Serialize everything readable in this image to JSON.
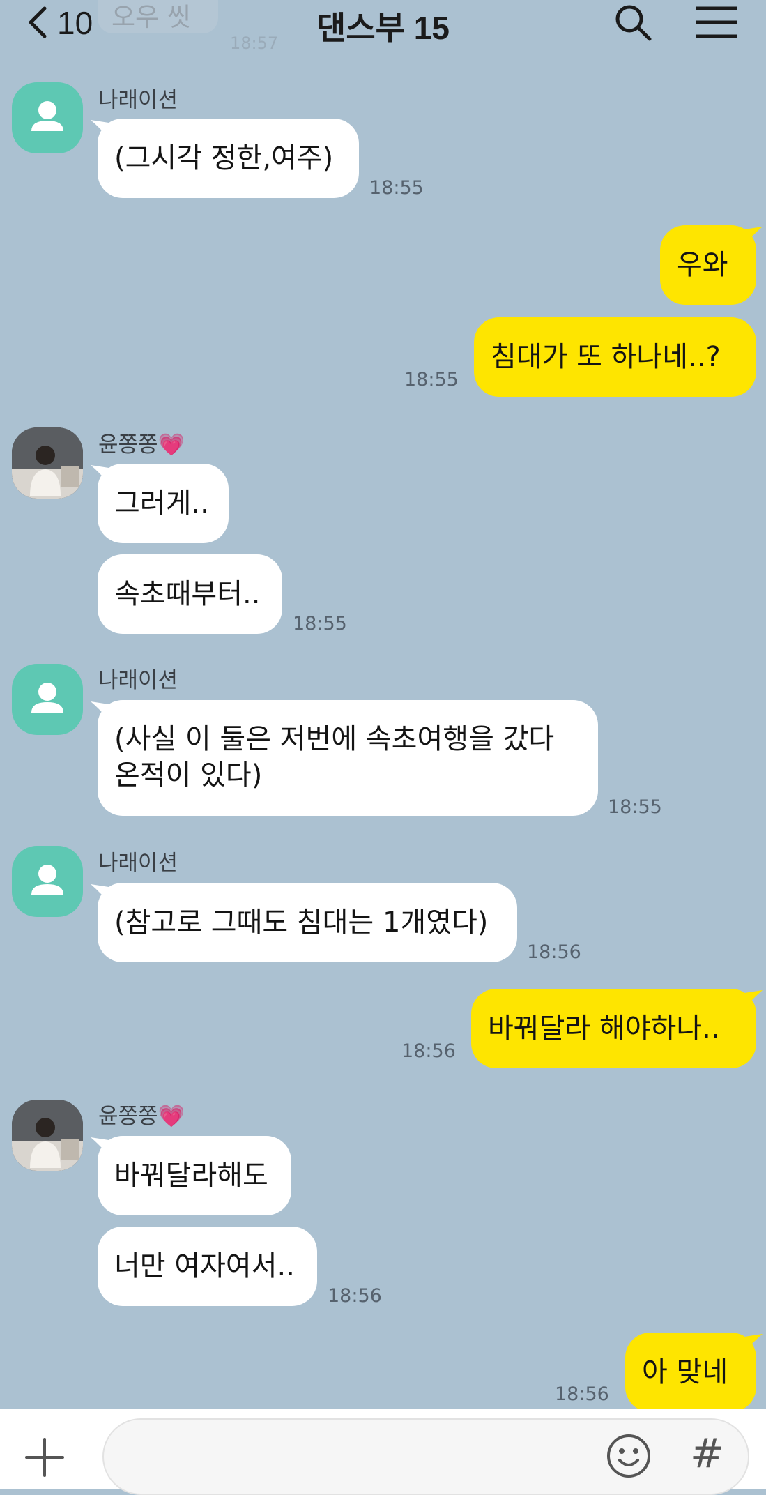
{
  "header": {
    "previous_message_text": "오우 씻",
    "previous_message_time": "18:57",
    "back_count": "10",
    "title": "댄스부 15",
    "back_icon": "chevron-left-icon",
    "search_icon": "search-icon",
    "menu_icon": "hamburger-menu-icon"
  },
  "colors": {
    "background": "#abc1d1",
    "my_bubble": "#fee500",
    "other_bubble": "#ffffff",
    "narrator_avatar": "#5ec8b3"
  },
  "messages": [
    {
      "sender": "나래이션",
      "text": "(그시각 정한,여주)",
      "time": "18:55"
    },
    {
      "sender": "me",
      "text": "우와"
    },
    {
      "sender": "me",
      "text": "침대가 또 하나네..?",
      "time": "18:55"
    },
    {
      "sender": "윤쫑쫑",
      "sender_emoji": "💗",
      "text": "그러게.."
    },
    {
      "sender": "윤쫑쫑",
      "text": "속초때부터..",
      "time": "18:55"
    },
    {
      "sender": "나래이션",
      "text_line1": "(사실 이 둘은 저번에 속초여행을 갔다",
      "text_line2": "온적이 있다)",
      "time": "18:55"
    },
    {
      "sender": "나래이션",
      "text": "(참고로 그때도 침대는 1개였다)",
      "time": "18:56"
    },
    {
      "sender": "me",
      "text": "바꿔달라 해야하나..",
      "time": "18:56"
    },
    {
      "sender": "윤쫑쫑",
      "sender_emoji": "💗",
      "text": "바꿔달라해도"
    },
    {
      "sender": "윤쫑쫑",
      "text": "너만 여자여서..",
      "time": "18:56"
    },
    {
      "sender": "me",
      "text": "아 맞네",
      "time": "18:56"
    }
  ],
  "composer": {
    "plus_icon": "plus-icon",
    "emoji_icon": "emoji-icon",
    "hash_label": "#"
  }
}
